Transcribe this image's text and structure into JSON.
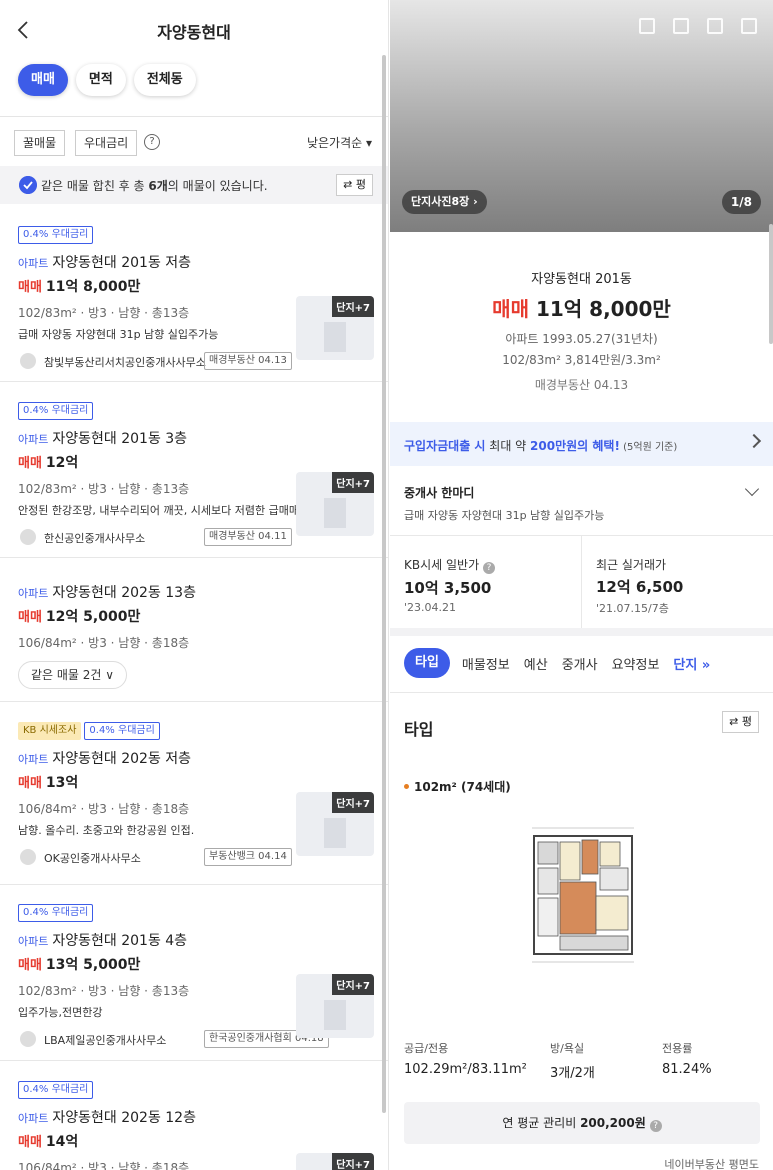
{
  "header": {
    "title": "자양동현대"
  },
  "chips": [
    "매매",
    "면적",
    "전체동"
  ],
  "filters": {
    "hot": "꿀매물",
    "rate": "우대금리",
    "help": "?",
    "sort": "낮은가격순 ▾"
  },
  "notice": {
    "pre": "같은 매물 합친 후 총 ",
    "count": "6개",
    "post": "의 매물이 있습니다.",
    "toggle": "⇄ 평"
  },
  "listings": [
    {
      "badge": "0.4% 우대금리",
      "type": "아파트",
      "name": "자양동현대 201동 저층",
      "kind": "매매",
      "price": "11억 8,000만",
      "spec": "102/83m² · 방3 · 남향 · 총13층",
      "desc": "급매 자양동 자양현대 31p 남향 실입주가능",
      "agent": "참빛부동산리서치공인중개사사무소",
      "src": "매경부동산 04.13",
      "thumb": "단지+7"
    },
    {
      "badge": "0.4% 우대금리",
      "type": "아파트",
      "name": "자양동현대 201동 3층",
      "kind": "매매",
      "price": "12억",
      "spec": "102/83m² · 방3 · 남향 · 총13층",
      "desc": "안정된 한강조망, 내부수리되어 깨끗, 시세보다 저렴한 급매매",
      "agent": "한신공인중개사사무소",
      "src": "매경부동산 04.11",
      "thumb": "단지+7"
    },
    {
      "type": "아파트",
      "name": "자양동현대 202동 13층",
      "kind": "매매",
      "price": "12억 5,000만",
      "spec": "106/84m² · 방3 · 남향 · 총18층",
      "dropdown": "같은 매물 2건 ∨"
    },
    {
      "badge_kb": "KB 시세조사",
      "badge": "0.4% 우대금리",
      "type": "아파트",
      "name": "자양동현대 202동 저층",
      "kind": "매매",
      "price": "13억",
      "spec": "106/84m² · 방3 · 남향 · 총18층",
      "desc": "남향. 올수리. 초중고와 한강공원 인접.",
      "agent": "OK공인중개사사무소",
      "src": "부동산뱅크 04.14",
      "thumb": "단지+7"
    },
    {
      "badge": "0.4% 우대금리",
      "type": "아파트",
      "name": "자양동현대 201동 4층",
      "kind": "매매",
      "price": "13억 5,000만",
      "spec": "102/83m² · 방3 · 남향 · 총13층",
      "desc": "입주가능,전면한강",
      "agent": "LBA제일공인중개사사무소",
      "src": "한국공인중개사협회 04.18",
      "thumb": "단지+7"
    },
    {
      "badge": "0.4% 우대금리",
      "type": "아파트",
      "name": "자양동현대 202동 12층",
      "kind": "매매",
      "price": "14억",
      "spec": "106/84m² · 방3 · 남향 · 총18층",
      "thumb": "단지+7"
    }
  ],
  "detail": {
    "photo_btn": "단지사진8장 ›",
    "photo_count": "1/8",
    "building": "자양동현대 201동",
    "kind": "매매",
    "price": "11억 8,000만",
    "line1": "아파트 1993.05.27(31년차)",
    "line2": "102/83m² 3,814만원/3.3m²",
    "line3": "매경부동산 04.13",
    "loan_pre": "구입자금대출 시",
    "loan_mid": " 최대 약 ",
    "loan_hl": "200만원의 혜택!",
    "loan_note": " (5억원 기준)",
    "agent_head": "중개사 한마디",
    "agent_body": "급매 자양동 자양현대 31p 남향 실입주가능",
    "kb_label": "KB시세 일반가",
    "kb_value": "10억 3,500",
    "kb_date": "'23.04.21",
    "recent_label": "최근 실거래가",
    "recent_value": "12억 6,500",
    "recent_date": "'21.07.15/7층",
    "tabs": [
      "타입",
      "매물정보",
      "예산",
      "중개사",
      "요약정보",
      "단지 »"
    ],
    "type_title": "타입",
    "type_toggle": "⇄ 평",
    "type_area": "102m² (74세대)",
    "spec_supply_h": "공급/전용",
    "spec_supply_v": "102.29m²/83.11m²",
    "spec_room_h": "방/욕실",
    "spec_room_v": "3개/2개",
    "spec_ratio_h": "전용률",
    "spec_ratio_v": "81.24%",
    "fee_label": "연 평균 관리비 ",
    "fee_value": "200,200원",
    "fee_help": "?",
    "source": "네이버부동산 평면도"
  },
  "colors": {
    "accent": "#3d5ce8",
    "sale_red": "#e63a2e"
  }
}
